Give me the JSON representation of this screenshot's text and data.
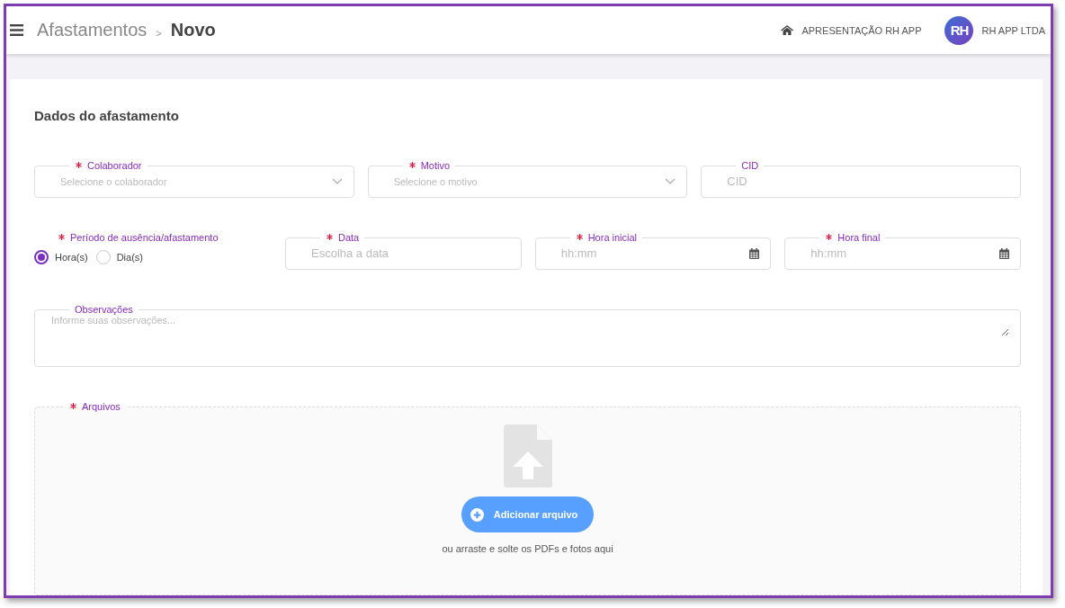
{
  "header": {
    "breadcrumb": [
      {
        "label": "Afastamentos",
        "current": false
      },
      {
        "label": ">",
        "kind": "separator"
      },
      {
        "label": "Novo",
        "current": true
      }
    ],
    "home_link": "APRESENTAÇÃO RH APP",
    "avatar": "RH",
    "company": "RH APP LTDA"
  },
  "section_title": "Dados do afastamento",
  "row_1": [
    {
      "kind": "select",
      "label": "Colaborador",
      "required": true,
      "placeholder": "Selecione o colaborador"
    },
    {
      "kind": "select",
      "label": "Motivo",
      "required": true,
      "placeholder": "Selecione o motivo"
    },
    {
      "kind": "text",
      "label": "CID",
      "required": false,
      "placeholder": "CID"
    }
  ],
  "period": {
    "label": "Período de ausência/afastamento",
    "required": true,
    "options": [
      {
        "label": "Hora(s)",
        "selected": true
      },
      {
        "label": "Dia(s)",
        "selected": false
      }
    ]
  },
  "row_2": [
    {
      "kind": "text",
      "label": "Data",
      "required": true,
      "placeholder": "Escolha a data"
    },
    {
      "kind": "time",
      "label": "Hora inicial",
      "required": true,
      "placeholder": "hh:mm"
    },
    {
      "kind": "time",
      "label": "Hora final",
      "required": true,
      "placeholder": "hh:mm"
    }
  ],
  "observations": {
    "label": "Observações",
    "required": false,
    "placeholder": "Informe suas observações..."
  },
  "files": {
    "label": "Arquivos",
    "required": true,
    "button": "Adicionar arquivo",
    "hint": "ou arraste e solte os PDFs e fotos aqui"
  }
}
